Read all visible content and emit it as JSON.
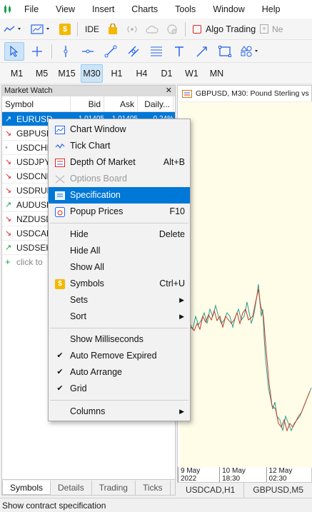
{
  "menubar": {
    "items": [
      "File",
      "View",
      "Insert",
      "Charts",
      "Tools",
      "Window",
      "Help"
    ]
  },
  "toolbar1": {
    "ide": "IDE",
    "algo": "Algo Trading",
    "new_trade": "Ne"
  },
  "timeframes": [
    "M1",
    "M5",
    "M15",
    "M30",
    "H1",
    "H4",
    "D1",
    "W1",
    "MN"
  ],
  "active_timeframe": "M30",
  "market_watch": {
    "title": "Market Watch",
    "columns": [
      "Symbol",
      "Bid",
      "Ask",
      "Daily..."
    ],
    "rows": [
      {
        "symbol": "EURUSD",
        "bid": "1.01405",
        "ask": "1.01405",
        "daily": "0.24%",
        "trend": "up"
      },
      {
        "symbol": "GBPUSD",
        "trend": "down"
      },
      {
        "symbol": "USDCHF",
        "trend": "flat"
      },
      {
        "symbol": "USDJPY",
        "trend": "down"
      },
      {
        "symbol": "USDCNH",
        "trend": "down"
      },
      {
        "symbol": "USDRUB",
        "trend": "down"
      },
      {
        "symbol": "AUDUSD",
        "trend": "up"
      },
      {
        "symbol": "NZDUSD",
        "trend": "down"
      },
      {
        "symbol": "USDCAD",
        "trend": "down"
      },
      {
        "symbol": "USDSEK",
        "trend": "up"
      }
    ],
    "add_hint": "click to",
    "tabs": [
      "Symbols",
      "Details",
      "Trading",
      "Ticks"
    ]
  },
  "chart": {
    "title": "GBPUSD, M30:  Pound Sterling vs US",
    "x_labels": [
      "9 May 2022",
      "10 May 18:30",
      "12 May 02:30"
    ],
    "tabs": [
      "USDCAD,H1",
      "GBPUSD,M5"
    ]
  },
  "context_menu": {
    "chart_window": "Chart Window",
    "tick_chart": "Tick Chart",
    "depth_of_market": "Depth Of Market",
    "depth_of_market_sc": "Alt+B",
    "options_board": "Options Board",
    "specification": "Specification",
    "popup_prices": "Popup Prices",
    "popup_prices_sc": "F10",
    "hide": "Hide",
    "hide_sc": "Delete",
    "hide_all": "Hide All",
    "show_all": "Show All",
    "symbols": "Symbols",
    "symbols_sc": "Ctrl+U",
    "sets": "Sets",
    "sort": "Sort",
    "show_ms": "Show Milliseconds",
    "auto_remove": "Auto Remove Expired",
    "auto_arrange": "Auto Arrange",
    "grid": "Grid",
    "columns": "Columns"
  },
  "status": "Show contract specification",
  "colors": {
    "accent": "#0078d7",
    "up": "#16a34a",
    "down": "#dc2626",
    "chart_bg": "#fffde7"
  }
}
